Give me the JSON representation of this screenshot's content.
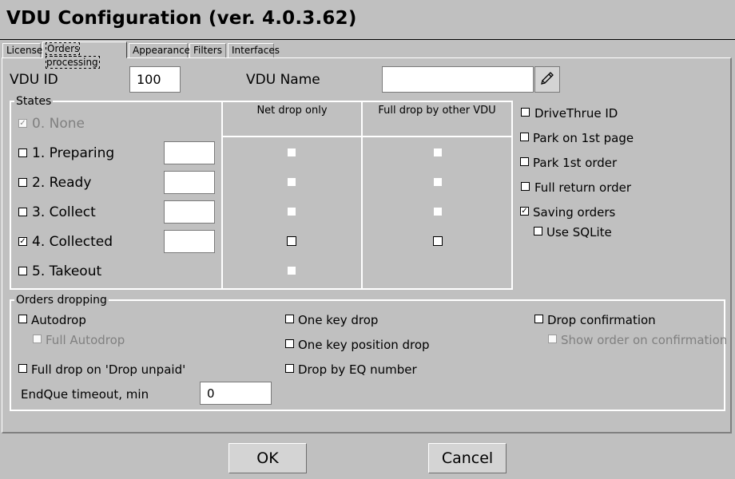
{
  "window": {
    "title": "VDU Configuration (ver. 4.0.3.62)"
  },
  "tabs": [
    {
      "label": "License"
    },
    {
      "label": "Orders processing"
    },
    {
      "label": "Appearance"
    },
    {
      "label": "Filters"
    },
    {
      "label": "Interfaces"
    }
  ],
  "vdu": {
    "id_label": "VDU ID",
    "id_value": "100",
    "name_label": "VDU Name",
    "name_value": ""
  },
  "states": {
    "group_label": "States",
    "col_net_drop": "Net drop only",
    "col_full_drop": "Full drop by other VDU",
    "rows": [
      {
        "label": "0. None",
        "checked": true
      },
      {
        "label": "1. Preparing",
        "checked": false
      },
      {
        "label": "2. Ready",
        "checked": false
      },
      {
        "label": "3. Collect",
        "checked": false
      },
      {
        "label": "4. Collected",
        "checked": true
      },
      {
        "label": "5. Takeout",
        "checked": false
      }
    ]
  },
  "options": {
    "drivethru_id": "DriveThrue ID",
    "park_first_page": "Park on 1st page",
    "park_first_order": "Park 1st order",
    "full_return_order": "Full return order",
    "saving_orders": "Saving orders",
    "use_sqlite": "Use SQLite"
  },
  "dropping": {
    "group_label": "Orders dropping",
    "autodrop": "Autodrop",
    "full_autodrop": "Full Autodrop",
    "full_drop_unpaid": "Full drop on 'Drop unpaid'",
    "one_key_drop": "One key drop",
    "one_key_position_drop": "One key position drop",
    "drop_by_eq": "Drop by EQ number",
    "drop_confirmation": "Drop confirmation",
    "show_order_on_confirmation": "Show order on confirmation",
    "endque_label": "EndQue timeout, min",
    "endque_value": "0"
  },
  "buttons": {
    "ok": "OK",
    "cancel": "Cancel"
  },
  "check_glyph": "☑"
}
